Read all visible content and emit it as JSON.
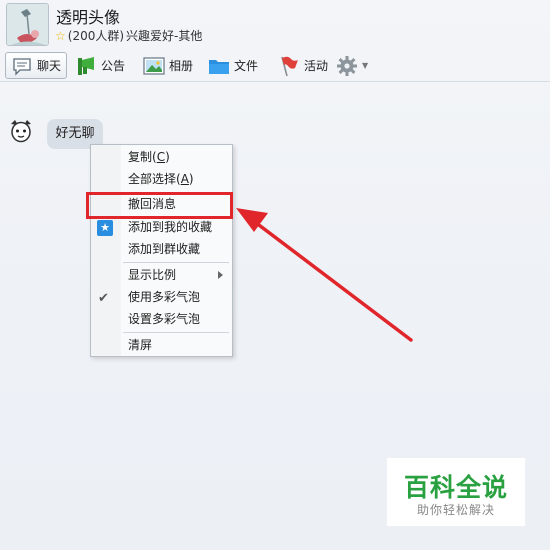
{
  "group": {
    "name": "透明头像",
    "member_count": "(200人群)",
    "category": "兴趣爱好-其他"
  },
  "toolbar": {
    "chat": "聊天",
    "notice": "公告",
    "album": "相册",
    "files": "文件",
    "events": "活动",
    "settings_icon": "gear-icon"
  },
  "message": {
    "text": "好无聊"
  },
  "context_menu": {
    "copy": {
      "label": "复制(",
      "key": "C",
      "end": ")"
    },
    "select_all": {
      "label": "全部选择(",
      "key": "A",
      "end": ")"
    },
    "recall": "撤回消息",
    "add_my_favorites": "添加到我的收藏",
    "add_group_favorites": "添加到群收藏",
    "zoom": "显示比例",
    "use_bubble": "使用多彩气泡",
    "set_bubble": "设置多彩气泡",
    "clear": "清屏"
  },
  "watermark": {
    "main": "百科全说",
    "sub": "助你轻松解决"
  },
  "colors": {
    "highlight": "#e0262b",
    "accent_blue": "#2a8ee0",
    "brand_green": "#2aa140"
  }
}
